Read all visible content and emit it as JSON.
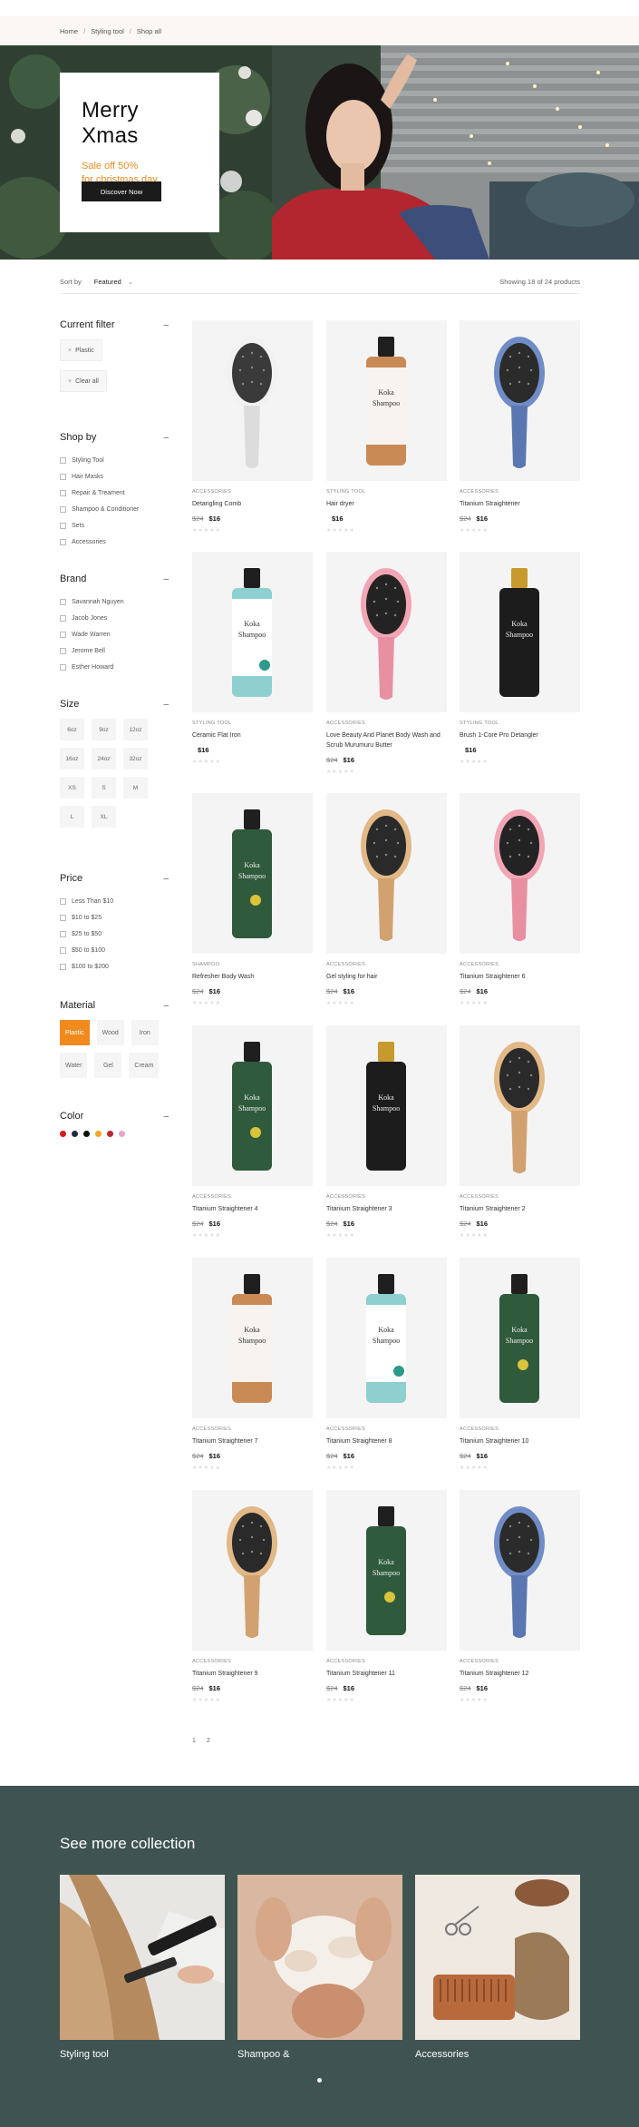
{
  "breadcrumb": [
    {
      "label": "Home"
    },
    {
      "label": "Styling tool"
    },
    {
      "label": "Shop all"
    }
  ],
  "hero": {
    "title": "Merry Xmas",
    "subtitle_line1": "Sale off 50%",
    "subtitle_line2": "for christmas day",
    "button_label": "Discover Now"
  },
  "sort": {
    "label": "Sort by",
    "value": "Featured",
    "showing": "Showing 18 of 24 products"
  },
  "filters": {
    "current": {
      "title": "Current filter",
      "chips": [
        "Plastic",
        "Clear all"
      ]
    },
    "shop_by": {
      "title": "Shop by",
      "items": [
        "Styling Tool",
        "Hair Masks",
        "Repair & Treament",
        "Shampoo & Conditioner",
        "Sets",
        "Accessories"
      ]
    },
    "brand": {
      "title": "Brand",
      "items": [
        "Savannah Nguyen",
        "Jacob Jones",
        "Wade Warren",
        "Jerome Bell",
        "Esther Howard"
      ]
    },
    "size": {
      "title": "Size",
      "items": [
        "6oz",
        "9oz",
        "12oz",
        "16oz",
        "24oz",
        "32oz",
        "XS",
        "S",
        "M",
        "L",
        "XL"
      ]
    },
    "price": {
      "title": "Price",
      "items": [
        "Less Than $10",
        "$10 to $25",
        "$25 to $50",
        "$50 to $100",
        "$100 to $200"
      ]
    },
    "material": {
      "title": "Material",
      "items": [
        "Plastic",
        "Wood",
        "Iron",
        "Water",
        "Gel",
        "Cream"
      ],
      "active": "Plastic"
    },
    "color": {
      "title": "Color",
      "swatches": [
        "#d71920",
        "#1f2a44",
        "#111111",
        "#f5a623",
        "#c0262d",
        "#e8a7c0"
      ]
    }
  },
  "products": [
    {
      "category": "ACCESSORIES",
      "name": "Detangling Comb",
      "old_price": "$24",
      "price": "$16",
      "art": "brush-white"
    },
    {
      "category": "STYLING TOOL",
      "name": "Hair dryer",
      "old_price": "",
      "price": "$16",
      "art": "bottle-brown"
    },
    {
      "category": "ACCESSORIES",
      "name": "Titanium Straightener",
      "old_price": "$24",
      "price": "$16",
      "art": "brush-blue"
    },
    {
      "category": "STYLING TOOL",
      "name": "Ceramic Flat Iron",
      "old_price": "",
      "price": "$16",
      "art": "bottle-teal"
    },
    {
      "category": "ACCESSORIES",
      "name": "Love Beauty And Planet Body Wash and Scrub Murumuru Butter",
      "old_price": "$24",
      "price": "$16",
      "art": "brush-pink"
    },
    {
      "category": "STYLING TOOL",
      "name": "Brush 1-Core Pro Detangler",
      "old_price": "",
      "price": "$16",
      "art": "bottle-black"
    },
    {
      "category": "SHAMPOO",
      "name": "Refresher Body Wash",
      "old_price": "$24",
      "price": "$16",
      "art": "bottle-green"
    },
    {
      "category": "ACCESSORIES",
      "name": "Gel styling for hair",
      "old_price": "$24",
      "price": "$16",
      "art": "brush-wood"
    },
    {
      "category": "ACCESSORIES",
      "name": "Titanium Straightener 6",
      "old_price": "$24",
      "price": "$16",
      "art": "brush-pink"
    },
    {
      "category": "ACCESSORIES",
      "name": "Titanium Straightener 4",
      "old_price": "$24",
      "price": "$16",
      "art": "bottle-green"
    },
    {
      "category": "ACCESSORIES",
      "name": "Titanium Straightener 3",
      "old_price": "$24",
      "price": "$16",
      "art": "bottle-black"
    },
    {
      "category": "ACCESSORIES",
      "name": "Titanium Straightener 2",
      "old_price": "$24",
      "price": "$16",
      "art": "brush-wood"
    },
    {
      "category": "ACCESSORIES",
      "name": "Titanium Straightener 7",
      "old_price": "$24",
      "price": "$16",
      "art": "bottle-brown"
    },
    {
      "category": "ACCESSORIES",
      "name": "Titanium Straightener 8",
      "old_price": "$24",
      "price": "$16",
      "art": "bottle-teal"
    },
    {
      "category": "ACCESSORIES",
      "name": "Titanium Straightener 10",
      "old_price": "$24",
      "price": "$16",
      "art": "bottle-green"
    },
    {
      "category": "ACCESSORIES",
      "name": "Titanium Straightener 9",
      "old_price": "$24",
      "price": "$16",
      "art": "brush-wood"
    },
    {
      "category": "ACCESSORIES",
      "name": "Titanium Straightener 11",
      "old_price": "$24",
      "price": "$16",
      "art": "bottle-green"
    },
    {
      "category": "ACCESSORIES",
      "name": "Titanium Straightener 12",
      "old_price": "$24",
      "price": "$16",
      "art": "brush-blue"
    }
  ],
  "product_label": "Koka Shampoo",
  "pagination": [
    "1",
    "2"
  ],
  "collection": {
    "title": "See more collection",
    "items": [
      {
        "label": "Styling tool"
      },
      {
        "label": "Shampoo &"
      },
      {
        "label": "Accessories"
      }
    ]
  },
  "colors": {
    "accent": "#f08a1d",
    "collection_bg": "#3f5450"
  }
}
